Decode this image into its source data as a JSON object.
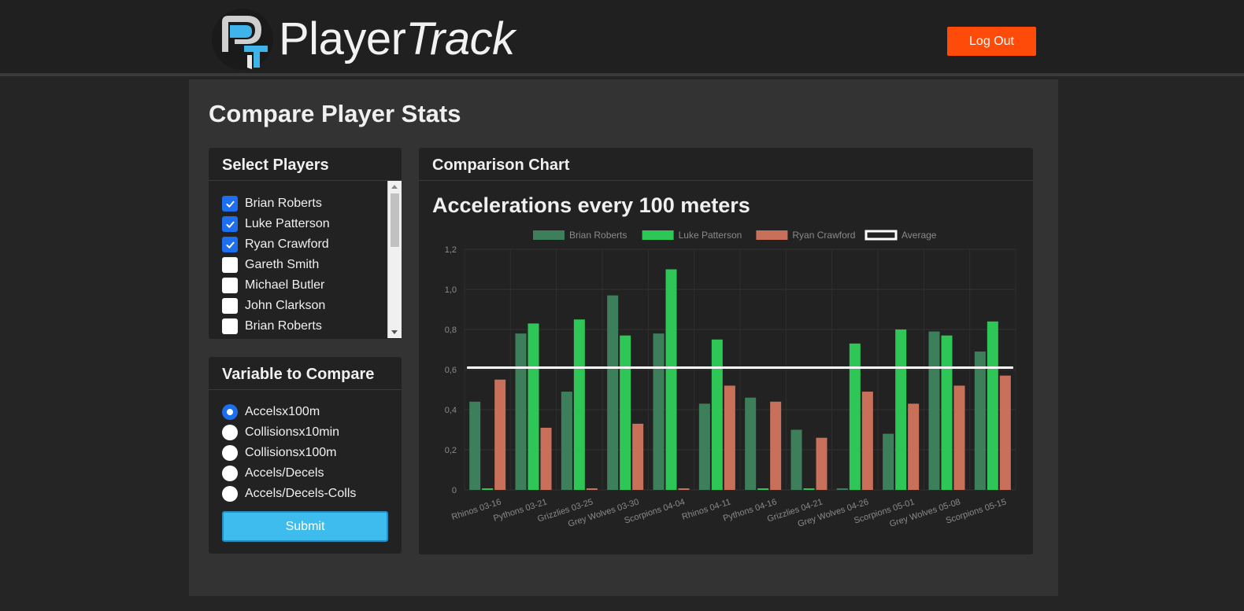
{
  "header": {
    "brand": {
      "part1": "Player",
      "part2": "Track"
    },
    "logout_label": "Log Out"
  },
  "page": {
    "title": "Compare Player Stats"
  },
  "select_players": {
    "title": "Select Players",
    "items": [
      {
        "label": "Brian Roberts",
        "checked": true
      },
      {
        "label": "Luke Patterson",
        "checked": true
      },
      {
        "label": "Ryan Crawford",
        "checked": true
      },
      {
        "label": "Gareth Smith",
        "checked": false
      },
      {
        "label": "Michael Butler",
        "checked": false
      },
      {
        "label": "John Clarkson",
        "checked": false
      },
      {
        "label": "Brian Roberts",
        "checked": false
      }
    ]
  },
  "variable": {
    "title": "Variable to Compare",
    "options": [
      {
        "label": "Accelsx100m",
        "checked": true
      },
      {
        "label": "Collisionsx10min",
        "checked": false
      },
      {
        "label": "Collisionsx100m",
        "checked": false
      },
      {
        "label": "Accels/Decels",
        "checked": false
      },
      {
        "label": "Accels/Decels-Colls",
        "checked": false
      }
    ],
    "submit_label": "Submit"
  },
  "comparison": {
    "card_title": "Comparison Chart"
  },
  "colors": {
    "brian": "#3d7f5a",
    "luke": "#2ec657",
    "ryan": "#c8705a",
    "average": "#ffffff",
    "accent_logout": "#ff4b0a",
    "accent_submit": "#3dbced"
  },
  "chart_data": {
    "type": "bar",
    "title": "Accelerations every 100 meters",
    "categories": [
      "Rhinos 03-16",
      "Pythons 03-21",
      "Grizzlies 03-25",
      "Grey Wolves 03-30",
      "Scorpions 04-04",
      "Rhinos 04-11",
      "Pythons 04-16",
      "Grizzlies 04-21",
      "Grey Wolves 04-26",
      "Scorpions 05-01",
      "Grey Wolves 05-08",
      "Scorpions 05-15"
    ],
    "series": [
      {
        "name": "Brian Roberts",
        "color": "#3d7f5a",
        "values": [
          0.44,
          0.78,
          0.49,
          0.97,
          0.78,
          0.43,
          0.46,
          0.3,
          0.0,
          0.28,
          0.79,
          0.69
        ]
      },
      {
        "name": "Luke Patterson",
        "color": "#2ec657",
        "values": [
          0.0,
          0.83,
          0.85,
          0.77,
          1.1,
          0.75,
          0.0,
          0.0,
          0.73,
          0.8,
          0.77,
          0.84
        ]
      },
      {
        "name": "Ryan Crawford",
        "color": "#c8705a",
        "values": [
          0.55,
          0.31,
          0.0,
          0.33,
          0.0,
          0.52,
          0.44,
          0.26,
          0.49,
          0.43,
          0.52,
          0.57
        ]
      }
    ],
    "average": {
      "name": "Average",
      "value": 0.61
    },
    "ylim": [
      0,
      1.2
    ],
    "yticks": [
      "0",
      "0,2",
      "0,4",
      "0,6",
      "0,8",
      "1,0",
      "1,2"
    ],
    "grid": true,
    "legend": "top-center"
  }
}
